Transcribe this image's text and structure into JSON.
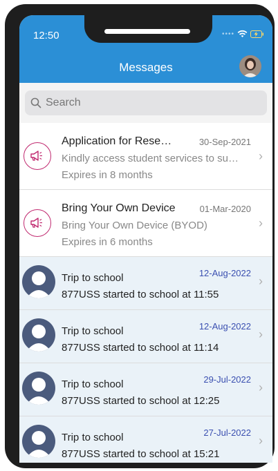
{
  "status_bar": {
    "time": "12:50"
  },
  "header": {
    "title": "Messages"
  },
  "search": {
    "placeholder": "Search"
  },
  "announcements": [
    {
      "title": "Application for Rese…",
      "date": "30-Sep-2021",
      "subtitle": "Kindly access student services to su…",
      "expiry": "Expires in 8 months"
    },
    {
      "title": "Bring Your Own Device",
      "date": "01-Mar-2020",
      "subtitle": "Bring Your Own Device (BYOD)",
      "expiry": "Expires in 6 months"
    }
  ],
  "trips": [
    {
      "title": "Trip to school",
      "date": "12-Aug-2022",
      "message": "877USS started to school at 11:55"
    },
    {
      "title": "Trip to school",
      "date": "12-Aug-2022",
      "message": "877USS started to school at 11:14"
    },
    {
      "title": "Trip to school",
      "date": "29-Jul-2022",
      "message": "877USS started to school at 12:25"
    },
    {
      "title": "Trip to school",
      "date": "27-Jul-2022",
      "message": "877USS started to school at 15:21"
    }
  ],
  "colors": {
    "header_bg": "#2b8fd6",
    "megaphone": "#c0276e",
    "trip_row_bg": "#eaf2f8",
    "trip_date": "#3a4fb0",
    "avatar_placeholder": "#4b5b7d"
  },
  "icons": {
    "announcement": "megaphone-icon",
    "trip": "person-placeholder-icon",
    "search": "search-icon",
    "row_action": "chevron-right-icon"
  }
}
